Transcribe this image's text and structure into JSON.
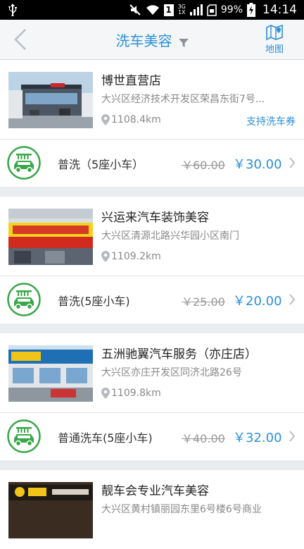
{
  "status_bar": {
    "battery_percent": "99%",
    "time": "14:14",
    "network": [
      "3G",
      "1X"
    ],
    "sim_slot": "1"
  },
  "header": {
    "title": "洗车美容",
    "map_label": "地图"
  },
  "shops": [
    {
      "name": "博世直营店",
      "address": "大兴区经济技术开发区荣昌东街7号...",
      "distance": "1108.4km",
      "coupon": "支持洗车券",
      "service": {
        "name": "普洗（5座小车）",
        "old_price": "￥60.00",
        "price": "￥30.00"
      }
    },
    {
      "name": "兴运来汽车装饰美容",
      "address": "大兴区清源北路兴华园小区南门",
      "distance": "1109.2km",
      "coupon": "",
      "service": {
        "name": "普洗(5座小车)",
        "old_price": "￥25.00",
        "price": "￥20.00"
      }
    },
    {
      "name": "五洲驰翼汽车服务（亦庄店）",
      "address": "大兴区亦庄开发区同济北路26号",
      "distance": "1109.8km",
      "coupon": "",
      "service": {
        "name": "普通洗车(5座小车)",
        "old_price": "￥40.00",
        "price": "￥32.00"
      }
    },
    {
      "name": "靓车会专业汽车美容",
      "address": "大兴区黄村镇丽园东里6号楼6号商业",
      "distance": "",
      "coupon": ""
    }
  ],
  "colors": {
    "accent": "#2b8fd8",
    "service_green": "#3aa64a"
  }
}
